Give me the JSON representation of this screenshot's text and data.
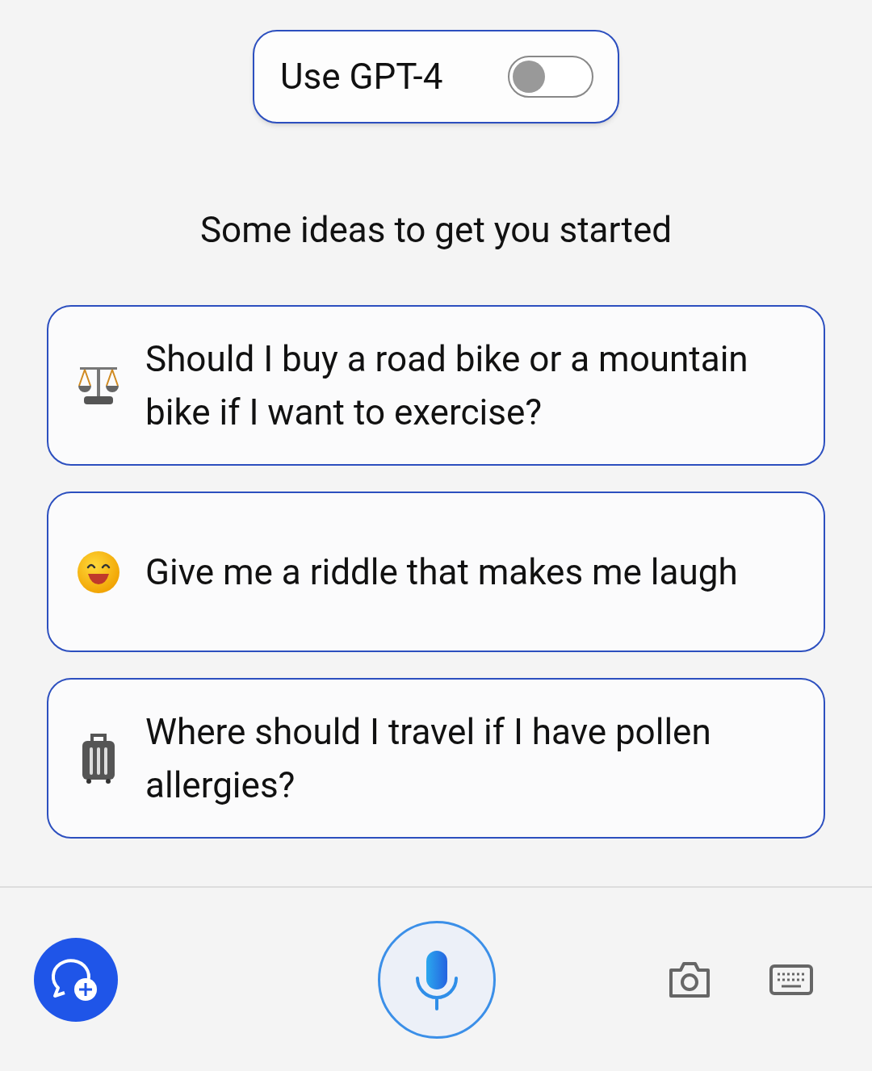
{
  "gpt4_toggle": {
    "label": "Use GPT-4",
    "on": false
  },
  "heading": "Some ideas to get you started",
  "suggestions": [
    {
      "kind": "scales",
      "text": "Should I buy a road bike or a mountain bike if I want to exercise?"
    },
    {
      "kind": "smile",
      "text": "Give me a riddle that makes me laugh"
    },
    {
      "kind": "luggage",
      "text": "Where should I travel if I have pollen allergies?"
    }
  ]
}
